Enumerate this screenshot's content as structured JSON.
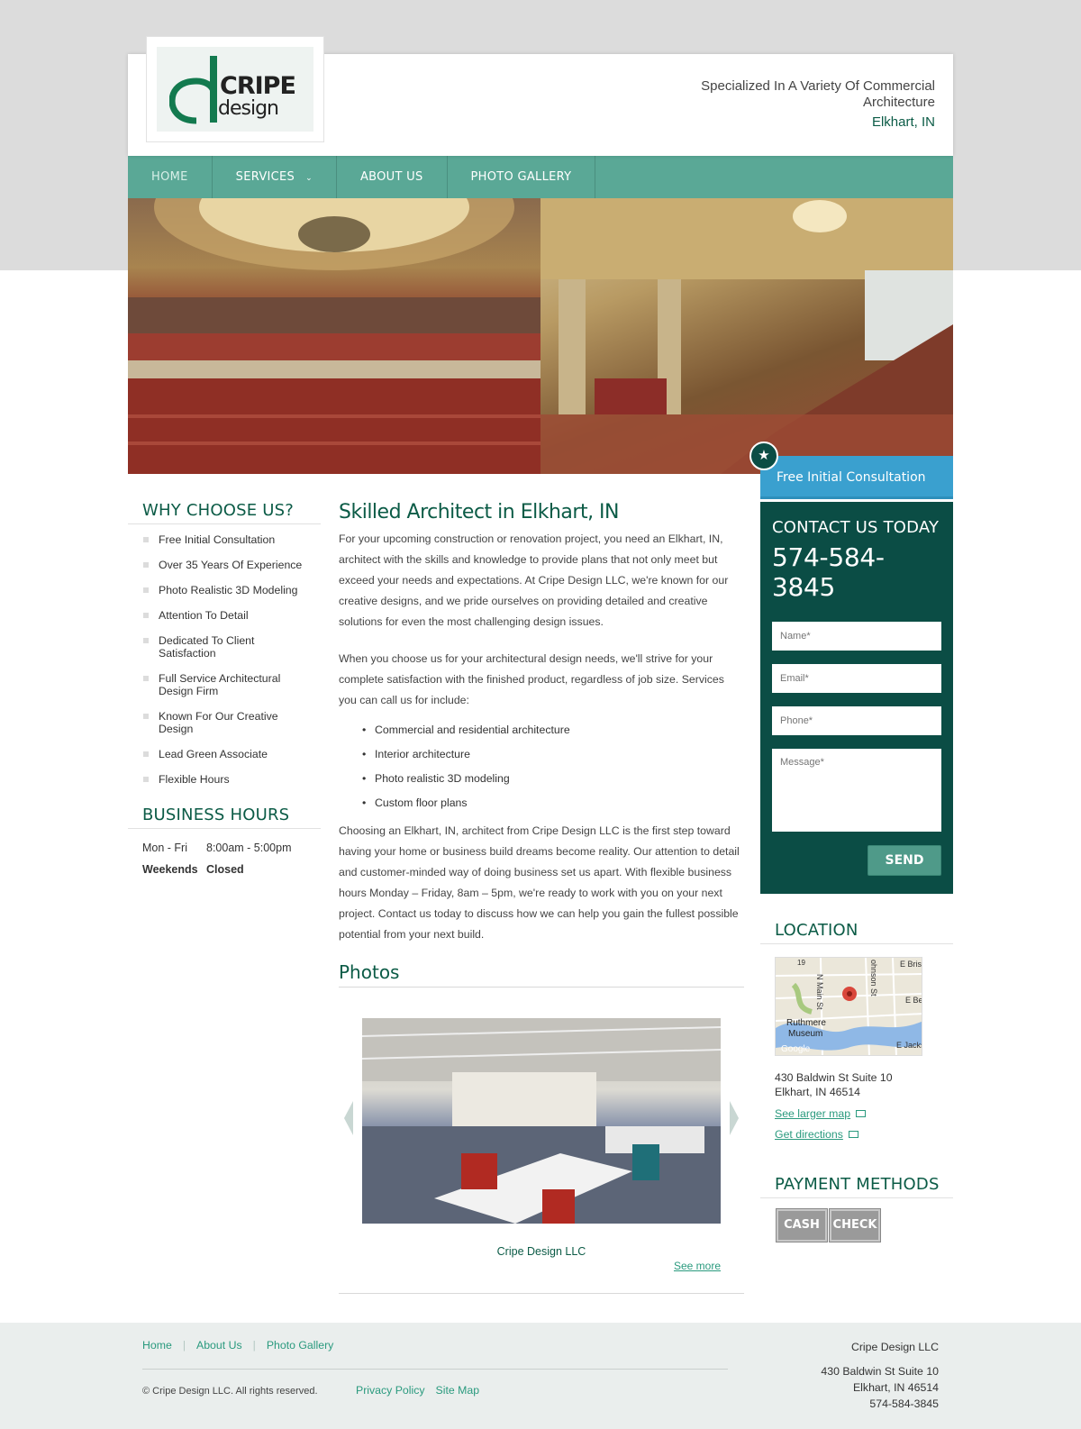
{
  "header": {
    "logo_word1": "CRIPE",
    "logo_word2": "design",
    "tagline": "Specialized In A Variety Of Commercial Architecture",
    "city": "Elkhart, IN"
  },
  "nav": {
    "items": [
      {
        "label": "HOME"
      },
      {
        "label": "SERVICES"
      },
      {
        "label": "ABOUT US"
      },
      {
        "label": "PHOTO GALLERY"
      }
    ]
  },
  "why": {
    "heading": "WHY CHOOSE US?",
    "items": [
      "Free Initial Consultation",
      "Over 35 Years Of Experience",
      "Photo Realistic 3D Modeling",
      "Attention To Detail",
      "Dedicated To Client Satisfaction",
      "Full Service Architectural Design Firm",
      "Known For Our Creative Design",
      "Lead Green Associate",
      "Flexible Hours"
    ]
  },
  "hours": {
    "heading": "BUSINESS HOURS",
    "rows": [
      {
        "day": "Mon - Fri",
        "time": "8:00am - 5:00pm"
      },
      {
        "day": "Weekends",
        "time": "Closed"
      }
    ]
  },
  "content": {
    "title": "Skilled Architect in Elkhart, IN",
    "para1": " For your upcoming construction or renovation project, you need an Elkhart, IN, architect with the skills and knowledge to provide plans that not only meet but exceed your needs and expectations. At Cripe Design LLC, we're known for our creative designs, and we pride ourselves on providing detailed and creative solutions for even the most challenging design issues.",
    "para2": " When you choose us for your architectural design needs, we'll strive for your complete satisfaction with the finished product, regardless of job size. Services you can call us for include:",
    "services": [
      "Commercial and residential architecture",
      "Interior architecture",
      "Photo realistic 3D modeling",
      "Custom floor plans"
    ],
    "para3": " Choosing an Elkhart, IN, architect from Cripe Design LLC is the first step toward having your home or business build dreams become reality. Our attention to detail and customer-minded way of doing business set us apart. With flexible business hours Monday – Friday, 8am – 5pm, we're ready to work with you on your next project. Contact us today to discuss how we can help you gain the fullest possible potential from your next build."
  },
  "photos": {
    "heading": "Photos",
    "caption": "Cripe Design LLC",
    "see_more": "See more"
  },
  "consult": {
    "label": "Free Initial Consultation"
  },
  "contact": {
    "heading": "CONTACT US TODAY",
    "phone": "574-584-3845",
    "name_placeholder": "Name*",
    "email_placeholder": "Email*",
    "phone_placeholder": "Phone*",
    "message_placeholder": "Message*",
    "send_label": "SEND"
  },
  "location": {
    "heading": "LOCATION",
    "map_labels": {
      "route": "19",
      "street1": "N Main St",
      "street2": "ohnson St",
      "street3": "E Brist",
      "street4": "E Be",
      "street5": "E Jackso",
      "poi1": "Ruthmere",
      "poi2": "Museum",
      "brand": "Google"
    },
    "address1": "430 Baldwin St Suite 10",
    "address2": "Elkhart, IN 46514",
    "larger_map": "See larger map",
    "directions": "Get directions"
  },
  "payment": {
    "heading": "PAYMENT METHODS",
    "methods": [
      "CASH",
      "CHECK"
    ]
  },
  "footer": {
    "links": [
      "Home",
      "About Us",
      "Photo Gallery"
    ],
    "copyright": "© Cripe Design LLC. All rights reserved.",
    "links2": [
      "Privacy Policy",
      "Site Map"
    ],
    "company": "Cripe Design LLC",
    "address1": "430 Baldwin St Suite 10",
    "address2": "Elkhart, IN 46514",
    "phone": "574-584-3845"
  },
  "colors": {
    "brand_green": "#0b5b46",
    "nav_green": "#5aa896",
    "contact_bg": "#0b4d45",
    "consult_blue": "#3aa0cf",
    "link": "#2a9a7e"
  }
}
